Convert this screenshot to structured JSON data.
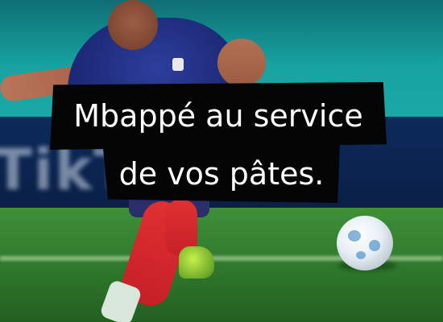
{
  "image": {
    "headline": {
      "line1": "Mbappé au service",
      "line2": "de vos pâtes."
    },
    "background_sign": "TikT"
  },
  "colors": {
    "banner_background": "#050505",
    "banner_text": "#ffffff",
    "stadium_teal": "#17a3a1",
    "jersey_blue": "#1d2a78",
    "pitch_green": "#2f7a2c",
    "sock_red": "#d6282c"
  }
}
